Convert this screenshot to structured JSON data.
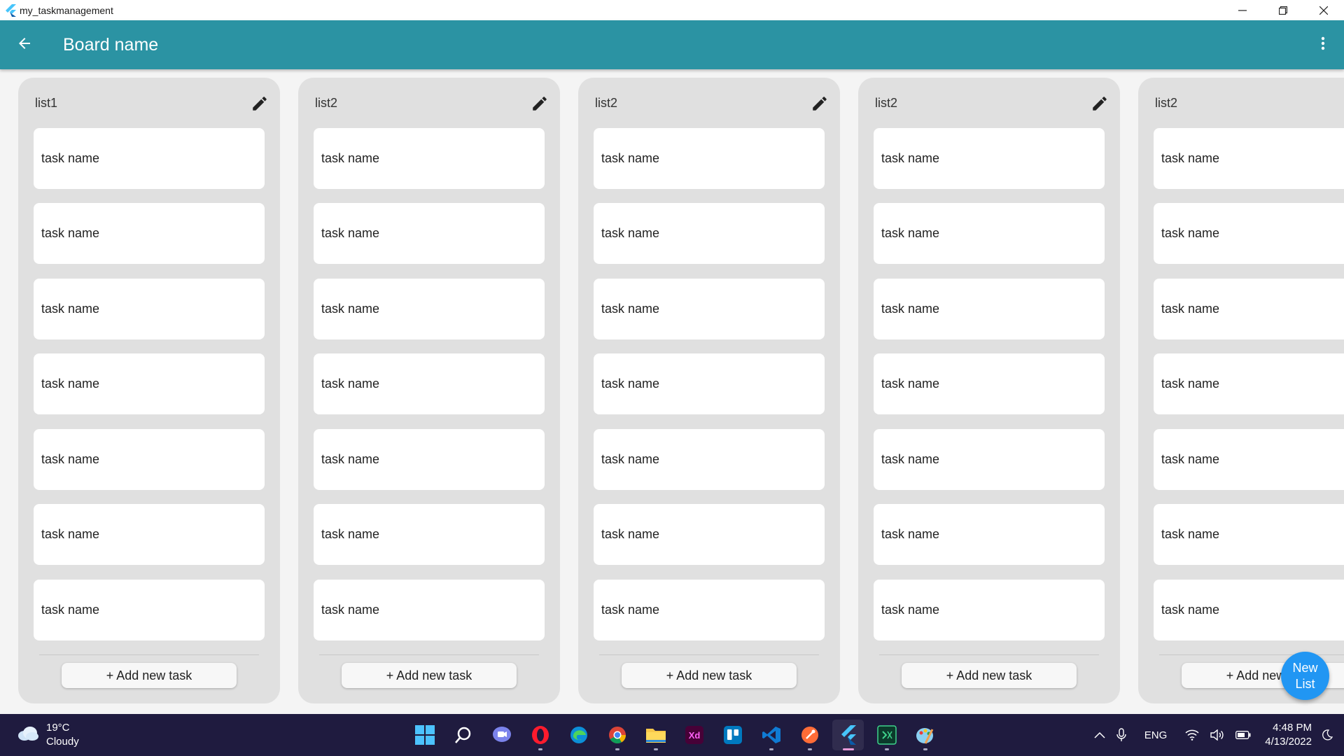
{
  "window": {
    "title": "my_taskmanagement",
    "controls": [
      "minimize",
      "restore",
      "close"
    ]
  },
  "appbar": {
    "title": "Board name",
    "color": "#2b93a3"
  },
  "lists": [
    {
      "title": "list1",
      "tasks": [
        "task name",
        "task name",
        "task name",
        "task name",
        "task name",
        "task name",
        "task name"
      ],
      "add_label": "+ Add new task"
    },
    {
      "title": "list2",
      "tasks": [
        "task name",
        "task name",
        "task name",
        "task name",
        "task name",
        "task name",
        "task name"
      ],
      "add_label": "+ Add new task"
    },
    {
      "title": "list2",
      "tasks": [
        "task name",
        "task name",
        "task name",
        "task name",
        "task name",
        "task name",
        "task name"
      ],
      "add_label": "+ Add new task"
    },
    {
      "title": "list2",
      "tasks": [
        "task name",
        "task name",
        "task name",
        "task name",
        "task name",
        "task name",
        "task name"
      ],
      "add_label": "+ Add new task"
    },
    {
      "title": "list2",
      "tasks": [
        "task name",
        "task name",
        "task name",
        "task name",
        "task name",
        "task name",
        "task name"
      ],
      "add_label": "+ Add new task"
    }
  ],
  "fab": {
    "line1": "New",
    "line2": "List",
    "color": "#2196f3"
  },
  "taskbar": {
    "weather_temp": "19°C",
    "weather_desc": "Cloudy",
    "apps": [
      "windows-start-icon",
      "search-icon",
      "chat-icon",
      "opera-icon",
      "edge-icon",
      "chrome-icon",
      "file-explorer-icon",
      "adobe-xd-icon",
      "trello-icon",
      "vscode-icon",
      "postman-icon",
      "flutter-icon",
      "terminal-icon",
      "paint-icon"
    ],
    "language": "ENG",
    "time": "4:48 PM",
    "date": "4/13/2022"
  }
}
